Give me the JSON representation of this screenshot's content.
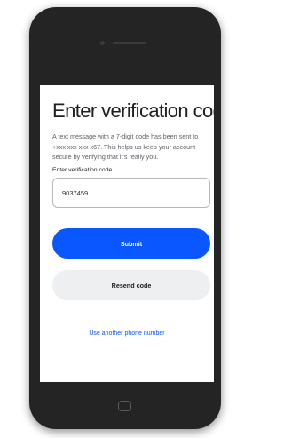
{
  "screen": {
    "title": "Enter verification code",
    "description": "A text message with a 7-digit code has been sent to +xxx xxx xxx x67. This helps us keep your account secure by verifying that it's really you.",
    "code_field": {
      "label": "Enter verification code",
      "value": "9037459"
    },
    "submit_label": "Submit",
    "resend_label": "Resend code",
    "alt_phone_link": "Use another phone number"
  },
  "colors": {
    "primary": "#0a57ff",
    "secondary_button": "#eeeff1",
    "phone_frame": "#242424"
  }
}
